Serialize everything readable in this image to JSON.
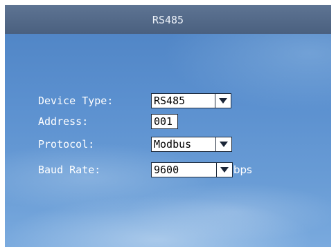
{
  "header": {
    "title": "RS485"
  },
  "form": {
    "device_type": {
      "label": "Device Type:",
      "value": "RS485"
    },
    "address": {
      "label": "Address:",
      "value": "001"
    },
    "protocol": {
      "label": "Protocol:",
      "value": "Modbus"
    },
    "baud_rate": {
      "label": "Baud Rate:",
      "value": "9600",
      "unit": "bps"
    }
  }
}
